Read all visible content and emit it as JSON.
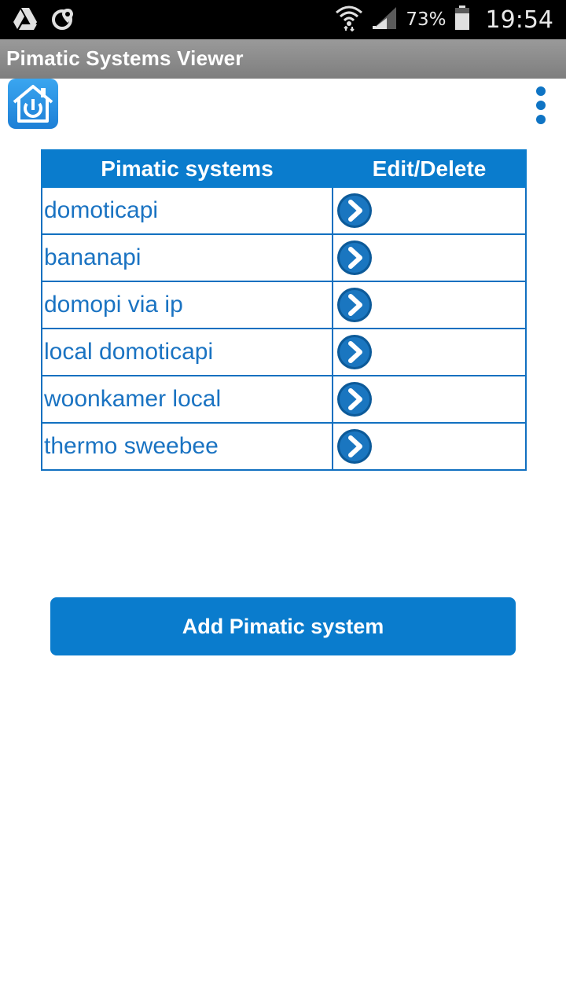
{
  "status_bar": {
    "battery_percent": "73%",
    "time": "19:54",
    "icons": [
      "drive-icon",
      "location-icon",
      "wifi-icon",
      "signal-icon",
      "battery-icon"
    ]
  },
  "app": {
    "title": "Pimatic Systems Viewer",
    "logo_icon": "home-power-icon",
    "menu_icon": "overflow-menu-icon"
  },
  "table": {
    "headers": [
      "Pimatic systems",
      "Edit/Delete"
    ],
    "rows": [
      {
        "name": "domoticapi"
      },
      {
        "name": "bananapi"
      },
      {
        "name": "domopi via ip"
      },
      {
        "name": "local domoticapi"
      },
      {
        "name": "woonkamer local"
      },
      {
        "name": "thermo sweebee"
      }
    ],
    "action_icon": "chevron-right-circle-icon"
  },
  "add_button": {
    "label": "Add Pimatic system"
  },
  "colors": {
    "accent": "#0a7ccd",
    "link_text": "#1a73c2",
    "title_bar": "#8c8c8c"
  }
}
